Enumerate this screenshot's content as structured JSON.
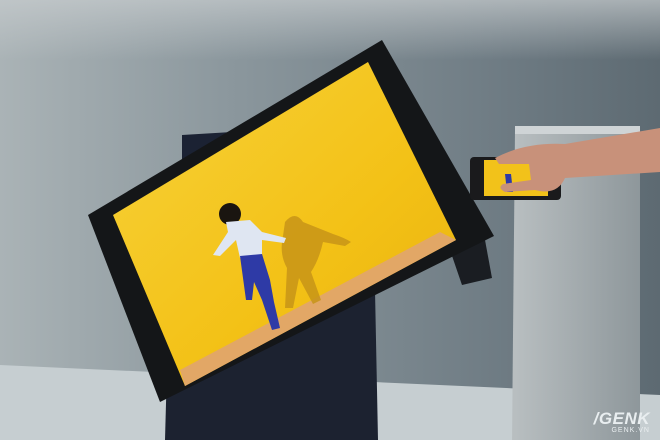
{
  "image": {
    "subject": "rotating-tv-portrait-mirroring-phone",
    "colors": {
      "wall": "#8a969c",
      "floor": "#c9d0d2",
      "screen": "#f4c418",
      "bezel": "#141618",
      "stand": "#1c2230",
      "pedestal": "#a9b0b3"
    }
  },
  "watermark": {
    "logo": "/GENK",
    "site": "GENK.VN"
  }
}
